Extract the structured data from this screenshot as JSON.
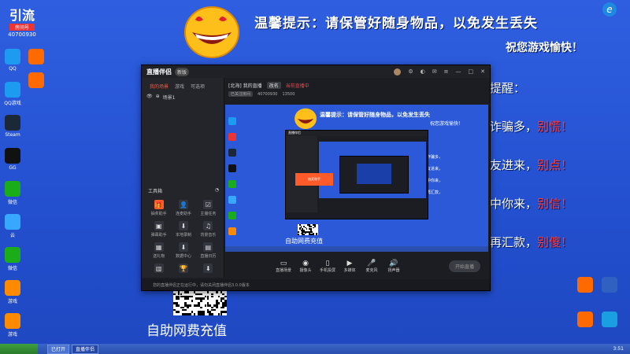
{
  "desktop": {
    "top_left_badge": "引流",
    "top_left_sub": "房间号",
    "top_left_num": "40700930",
    "icons_left": [
      {
        "label": "QQ",
        "color": "#1d9bf0"
      },
      {
        "label": "QQ游戏",
        "color": "#1d9bf0"
      },
      {
        "label": "Steam",
        "color": "#1b2838"
      },
      {
        "label": "GG",
        "color": "#111"
      },
      {
        "label": "微信",
        "color": "#1aad19"
      },
      {
        "label": "云",
        "color": "#38a8ff"
      },
      {
        "label": "微信",
        "color": "#1aad19"
      },
      {
        "label": "游戏",
        "color": "#ff8a00"
      },
      {
        "label": "游戏",
        "color": "#ff8a00"
      }
    ],
    "icons_left2": [
      {
        "label": "",
        "color": "#ff6a00"
      },
      {
        "label": "",
        "color": "#ff6a00"
      }
    ],
    "icons_right": [
      {
        "label": "",
        "color": "#ff6a00"
      },
      {
        "label": "",
        "color": "#3060c0"
      },
      {
        "label": "",
        "color": "#ff6a00"
      },
      {
        "label": "",
        "color": "#1aa0e0"
      }
    ],
    "banner_title": "温馨提示：请保管好随身物品，以免发生丢失",
    "banner_sub": "祝您游戏愉快！",
    "warnings": [
      {
        "text": "提醒：",
        "red": ""
      },
      {
        "text": "诈骗多，",
        "red": "别慌！"
      },
      {
        "text": "友进来，",
        "red": "别点！"
      },
      {
        "text": "中你来，",
        "red": "别信！"
      },
      {
        "text": "再汇款，",
        "red": "别傻！"
      }
    ],
    "recharge_text": "自助网费充值"
  },
  "window": {
    "logo": "直播伴侣",
    "badge": "新版",
    "tabs": [
      "我的场景",
      "游戏",
      "可选项"
    ],
    "scene_label": "场景1",
    "tools_title": "工具箱",
    "tools": [
      {
        "label": "抽奖助手",
        "icon": "🎁",
        "active": true
      },
      {
        "label": "连麦助手",
        "icon": "👤",
        "active": false
      },
      {
        "label": "主播任务",
        "icon": "☑",
        "active": false
      },
      {
        "label": "弹幕助手",
        "icon": "▣",
        "active": false
      },
      {
        "label": "本地录制",
        "icon": "⬇",
        "active": false
      },
      {
        "label": "背景音乐",
        "icon": "♫",
        "active": false
      },
      {
        "label": "送礼物",
        "icon": "▦",
        "active": false
      },
      {
        "label": "数据中心",
        "icon": "⬇",
        "active": false
      },
      {
        "label": "直播日历",
        "icon": "▤",
        "active": false
      },
      {
        "label": "",
        "icon": "▥",
        "active": false
      },
      {
        "label": "",
        "icon": "🏆",
        "active": false
      },
      {
        "label": "",
        "icon": "⬇",
        "active": false
      }
    ],
    "stream_title": "[北海] 我的直播",
    "stream_tag": "改名",
    "stream_red": "当前直播中",
    "stream_row2": [
      "已关注房间",
      "40700930",
      "13500"
    ],
    "status_text": "您的直播伴侣正在运行中，请勿关闭直播伴侣3.0.0版本",
    "bottom_items": [
      {
        "label": "直播场景",
        "icon": "▭"
      },
      {
        "label": "摄像头",
        "icon": "◉"
      },
      {
        "label": "手机投屏",
        "icon": "▯"
      },
      {
        "label": "多媒体",
        "icon": "▶"
      },
      {
        "label": "麦克风",
        "icon": "🎤"
      },
      {
        "label": "扬声器",
        "icon": "🔊"
      }
    ],
    "start_live": "开始直播"
  },
  "taskbar": {
    "buttons": [
      {
        "label": "已打开",
        "active": false
      },
      {
        "label": "直播伴侣",
        "active": true
      }
    ],
    "clock": "3:51"
  }
}
